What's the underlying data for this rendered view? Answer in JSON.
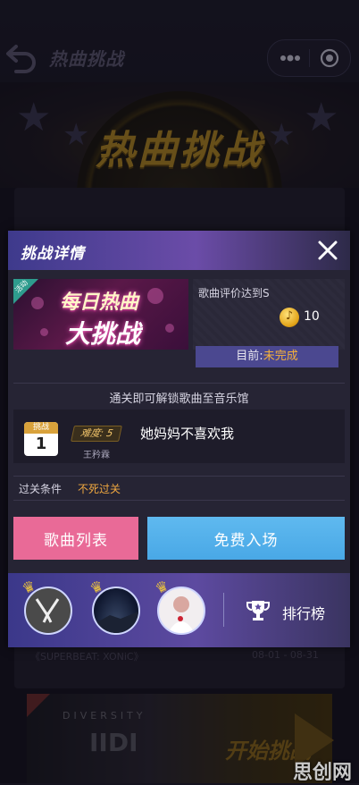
{
  "topbar": {
    "title": "热曲挑战"
  },
  "banner": {
    "title": "热曲挑战"
  },
  "background": {
    "card1_title": "《SUPERBEAT: XONiC》",
    "card1_dates": "08-01 - 08-31",
    "card2_logo": "DIVERSITY",
    "card2_big": "IIDI",
    "card2_cta": "开始挑战",
    "watermark": "思创网"
  },
  "modal": {
    "title": "挑战详情",
    "image": {
      "tag": "活动",
      "line1": "每日热曲",
      "line2": "大挑战"
    },
    "reward": {
      "label": "歌曲评价达到S",
      "coin_glyph": "♪",
      "count": "10"
    },
    "status": {
      "prefix": "目前:",
      "value": "未完成"
    },
    "unlock_text": "通关即可解锁歌曲至音乐馆",
    "song": {
      "calendar_label": "挑战",
      "calendar_day": "1",
      "difficulty": "难度: 5",
      "name": "她妈妈不喜欢我",
      "artist": "王矜霖"
    },
    "condition": {
      "label": "过关条件",
      "value": "不死过关"
    },
    "buttons": {
      "song_list": "歌曲列表",
      "free_entry": "免费入场"
    },
    "leaderboard": {
      "label": "排行榜"
    }
  },
  "colors": {
    "accent_pink": "#e96a97",
    "accent_blue": "#49a8e6",
    "status_orange": "#f5b13c",
    "header_purple": "#6b4ca8"
  },
  "icons": [
    "back-icon",
    "more-icon",
    "target-icon",
    "close-icon",
    "coin-icon",
    "calendar-icon",
    "crown-icon",
    "trophy-icon"
  ]
}
